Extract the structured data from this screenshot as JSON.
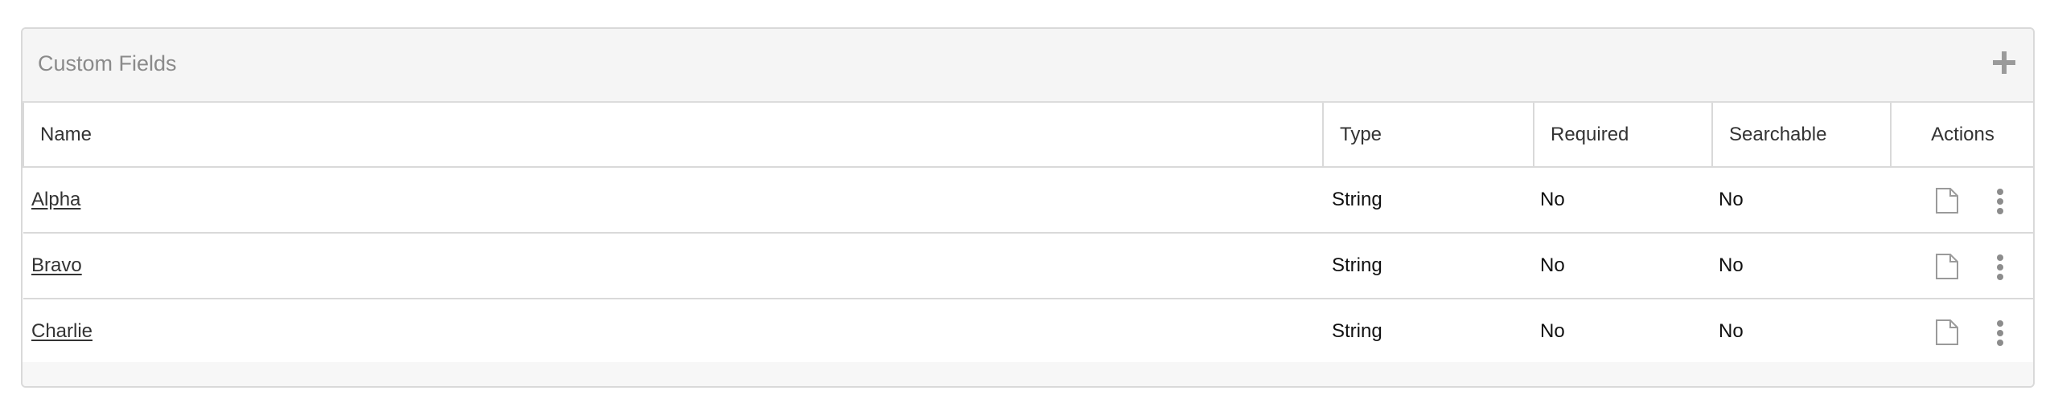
{
  "panel": {
    "title": "Custom Fields",
    "add_icon": "plus-icon"
  },
  "table": {
    "columns": [
      "Name",
      "Type",
      "Required",
      "Searchable",
      "Actions"
    ],
    "rows": [
      {
        "name": "Alpha",
        "type": "String",
        "required": "No",
        "searchable": "No"
      },
      {
        "name": "Bravo",
        "type": "String",
        "required": "No",
        "searchable": "No"
      },
      {
        "name": "Charlie",
        "type": "String",
        "required": "No",
        "searchable": "No"
      }
    ],
    "row_action_icons": [
      "document-icon",
      "more-vertical-icon"
    ]
  },
  "colors": {
    "border": "#d9d9d9",
    "header_bg": "#f5f5f5",
    "title_text": "#8a8a8a",
    "icon_gray": "#9a9a9a"
  }
}
